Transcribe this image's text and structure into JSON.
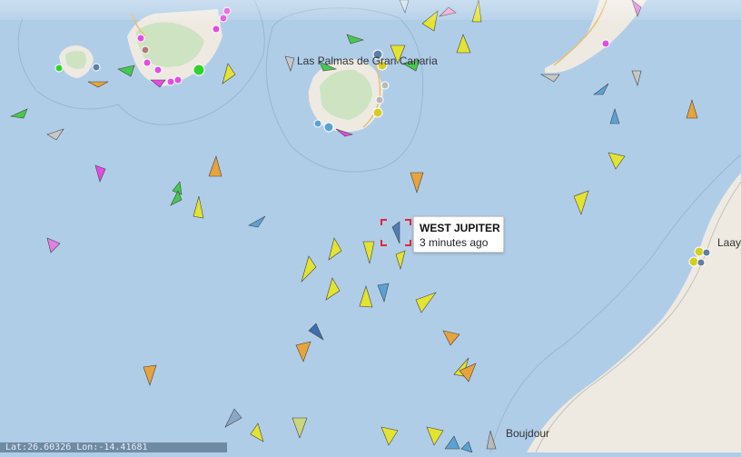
{
  "map": {
    "places": {
      "las_palmas": "Las Palmas de Gran Canaria",
      "boujdour": "Boujdour",
      "laayoune": "Laay"
    },
    "tooltip": {
      "vessel_name": "WEST JUPITER",
      "last_seen": "3 minutes ago"
    },
    "status_bar": {
      "text": "Lat:26.60326   Lon:-14.41681"
    },
    "colors": {
      "sea": "#b0cde8",
      "land": "#eeeae2",
      "vegetation": "#cde3c2",
      "tanker": "#e8a33a",
      "cargo": "#e3e331",
      "passenger": "#2f7de1",
      "fishing": "#f26f8b",
      "tug": "#45c94f",
      "pleasure": "#e44ce0",
      "selection": "#e2263a"
    }
  }
}
